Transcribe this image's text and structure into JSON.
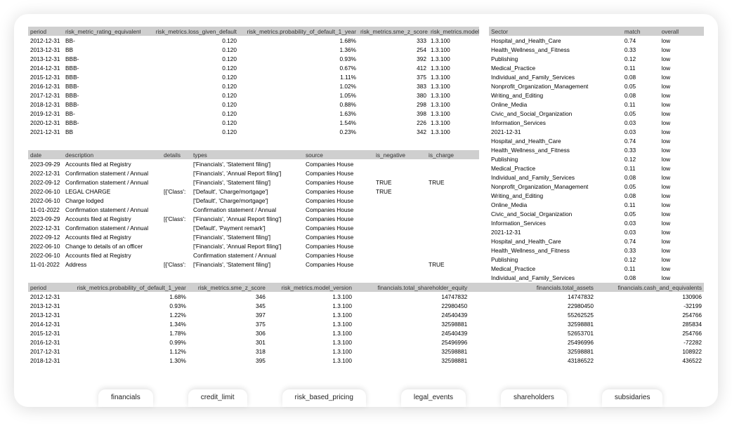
{
  "table1": {
    "headers": [
      "period",
      "risk_metric_rating_equivalent",
      "risk_metrics.loss_given_default",
      "risk_metrics.probability_of_default_1_year",
      "risk_metrics.sme_z_score",
      "risk_metrics.model_version"
    ],
    "rows": [
      [
        "2012-12-31",
        "BB-",
        "0.120",
        "1.68%",
        "333",
        "1.3.100"
      ],
      [
        "2013-12-31",
        "BB",
        "0.120",
        "1.36%",
        "254",
        "1.3.100"
      ],
      [
        "2013-12-31",
        "BBB-",
        "0.120",
        "0.93%",
        "392",
        "1.3.100"
      ],
      [
        "2014-12-31",
        "BBB-",
        "0.120",
        "0.67%",
        "412",
        "1.3.100"
      ],
      [
        "2015-12-31",
        "BBB-",
        "0.120",
        "1.11%",
        "375",
        "1.3.100"
      ],
      [
        "2016-12-31",
        "BBB-",
        "0.120",
        "1.02%",
        "383",
        "1.3.100"
      ],
      [
        "2017-12-31",
        "BBB-",
        "0.120",
        "1.05%",
        "380",
        "1.3.100"
      ],
      [
        "2018-12-31",
        "BBB-",
        "0.120",
        "0.88%",
        "298",
        "1.3.100"
      ],
      [
        "2019-12-31",
        "BB-",
        "0.120",
        "1.63%",
        "398",
        "1.3.100"
      ],
      [
        "2020-12-31",
        "BBB-",
        "0.120",
        "1.54%",
        "226",
        "1.3.100"
      ],
      [
        "2021-12-31",
        "BB",
        "0.120",
        "0.23%",
        "342",
        "1.3.100"
      ]
    ]
  },
  "table2": {
    "headers": [
      "Sector",
      "match",
      "overall"
    ],
    "rows": [
      [
        "Hospital_and_Health_Care",
        "0.74",
        "low"
      ],
      [
        "Health_Wellness_and_Fitness",
        "0.33",
        "low"
      ],
      [
        "Publishing",
        "0.12",
        "low"
      ],
      [
        "Medical_Practice",
        "0.11",
        "low"
      ],
      [
        "Individual_and_Family_Services",
        "0.08",
        "low"
      ],
      [
        "Nonprofit_Organization_Management",
        "0.05",
        "low"
      ],
      [
        "Writing_and_Editing",
        "0.08",
        "low"
      ],
      [
        "Online_Media",
        "0.11",
        "low"
      ],
      [
        "Civic_and_Social_Organization",
        "0.05",
        "low"
      ],
      [
        "Information_Services",
        "0.03",
        "low"
      ],
      [
        "2021-12-31",
        "0.03",
        "low"
      ],
      [
        "Hospital_and_Health_Care",
        "0.74",
        "low"
      ],
      [
        "Health_Wellness_and_Fitness",
        "0.33",
        "low"
      ],
      [
        "Publishing",
        "0.12",
        "low"
      ],
      [
        "Medical_Practice",
        "0.11",
        "low"
      ],
      [
        "Individual_and_Family_Services",
        "0.08",
        "low"
      ],
      [
        "Nonprofit_Organization_Management",
        "0.05",
        "low"
      ],
      [
        "Writing_and_Editing",
        "0.08",
        "low"
      ],
      [
        "Online_Media",
        "0.11",
        "low"
      ],
      [
        "Civic_and_Social_Organization",
        "0.05",
        "low"
      ],
      [
        "Information_Services",
        "0.03",
        "low"
      ],
      [
        "2021-12-31",
        "0.03",
        "low"
      ],
      [
        "Hospital_and_Health_Care",
        "0.74",
        "low"
      ],
      [
        "Health_Wellness_and_Fitness",
        "0.33",
        "low"
      ],
      [
        "Publishing",
        "0.12",
        "low"
      ],
      [
        "Medical_Practice",
        "0.11",
        "low"
      ],
      [
        "Individual_and_Family_Services",
        "0.08",
        "low"
      ]
    ]
  },
  "table3": {
    "headers": [
      "date",
      "description",
      "details",
      "types",
      "source",
      "is_negative",
      "is_charge"
    ],
    "rows": [
      [
        "2023-09-29",
        "Accounts filed at Registry",
        "",
        "['Financials', 'Statement filing']",
        "Companies House",
        "",
        ""
      ],
      [
        "2022-12-31",
        "Confirmation statement / Annual",
        "",
        "['Financials', 'Annual Report filing']",
        "Companies House",
        "",
        ""
      ],
      [
        "2022-09-12",
        "Confirmation statement / Annual",
        "",
        "['Financials', 'Statement filing']",
        "Companies House",
        "TRUE",
        "TRUE"
      ],
      [
        "2022-06-10",
        "LEGAL CHARGE",
        "[{'Class':",
        "['Default', 'Charge/mortgage']",
        "Companies House",
        "TRUE",
        ""
      ],
      [
        "2022-06-10",
        "Charge lodged",
        "",
        "['Default', 'Charge/mortgage']",
        "Companies House",
        "",
        ""
      ],
      [
        "11-01-2022",
        "Confirmation statement / Annual",
        "",
        "Confirmation statement / Annual",
        "Companies House",
        "",
        ""
      ],
      [
        "2023-09-29",
        "Accounts filed at Registry",
        "[{'Class':",
        "['Financials', 'Annual Report filing']",
        "Companies House",
        "",
        ""
      ],
      [
        "2022-12-31",
        "Confirmation statement / Annual",
        "",
        "['Default', 'Payment remark']",
        "Companies House",
        "",
        ""
      ],
      [
        "2022-09-12",
        "Accounts filed at Registry",
        "",
        "['Financials', 'Statement filing']",
        "Companies House",
        "",
        ""
      ],
      [
        "2022-06-10",
        "Change to details of an officer",
        "",
        "['Financials', 'Annual Report filing']",
        "Companies House",
        "",
        ""
      ],
      [
        "2022-06-10",
        "Accounts filed at Registry",
        "",
        "Confirmation statement / Annual",
        "Companies House",
        "",
        ""
      ],
      [
        "11-01-2022",
        "Address",
        "[{'Class':",
        "['Financials', 'Statement filing']",
        "Companies House",
        "",
        "TRUE"
      ]
    ]
  },
  "table4": {
    "headers": [
      "period",
      "risk_metrics.probability_of_default_1_year",
      "risk_metrics.sme_z_score",
      "risk_metrics.model_version",
      "financials.total_shareholder_equity",
      "financials.total_assets",
      "financials.cash_and_equivalents"
    ],
    "rows": [
      [
        "2012-12-31",
        "1.68%",
        "346",
        "1.3.100",
        "14747832",
        "14747832",
        "130906"
      ],
      [
        "2013-12-31",
        "0.93%",
        "345",
        "1.3.100",
        "22980450",
        "22980450",
        "-32199"
      ],
      [
        "2013-12-31",
        "1.22%",
        "397",
        "1.3.100",
        "24540439",
        "55262525",
        "254766"
      ],
      [
        "2014-12-31",
        "1.34%",
        "375",
        "1.3.100",
        "32598881",
        "32598881",
        "285834"
      ],
      [
        "2015-12-31",
        "1.78%",
        "306",
        "1.3.100",
        "24540439",
        "52653701",
        "254766"
      ],
      [
        "2016-12-31",
        "0.99%",
        "301",
        "1.3.100",
        "25496996",
        "25496996",
        "-72282"
      ],
      [
        "2017-12-31",
        "1.12%",
        "318",
        "1.3.100",
        "32598881",
        "32598881",
        "108922"
      ],
      [
        "2018-12-31",
        "1.30%",
        "395",
        "1.3.100",
        "32598881",
        "43186522",
        "436522"
      ]
    ]
  },
  "tabs": [
    "financials",
    "credit_limit",
    "risk_based_pricing",
    "legal_events",
    "shareholders",
    "subsidaries"
  ]
}
